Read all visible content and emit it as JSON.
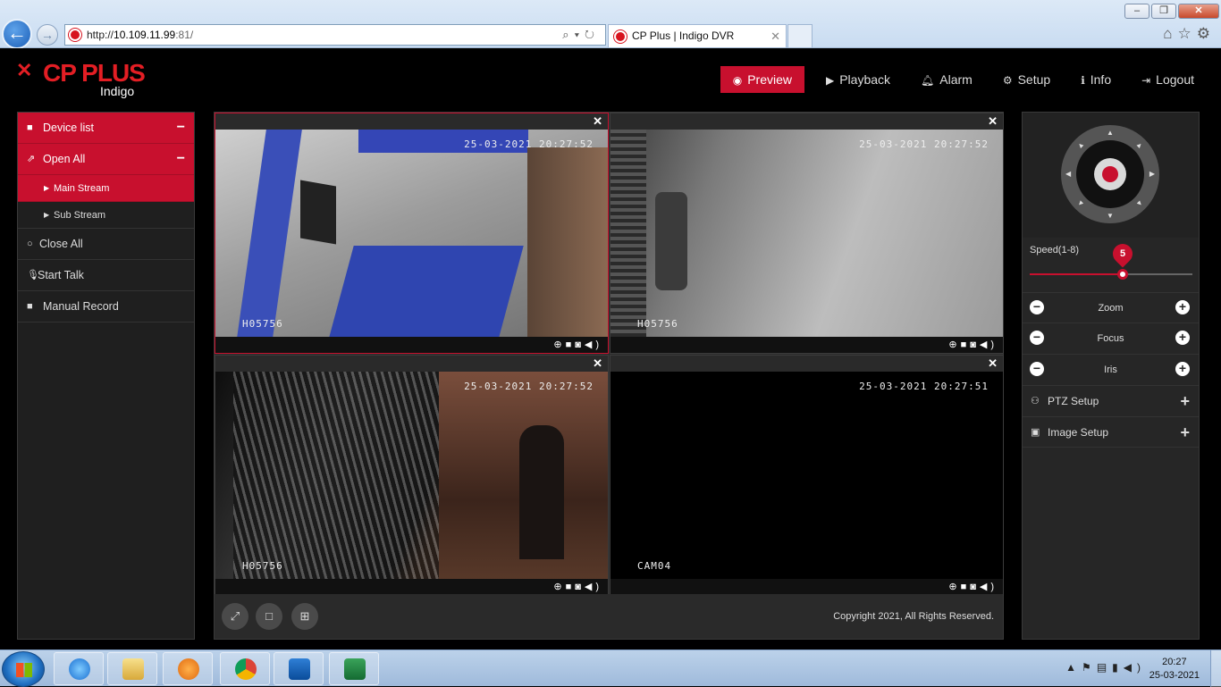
{
  "browser": {
    "url_prefix": "http://",
    "url_host": "10.109.11.99",
    "url_rest": ":81/",
    "tab_title": "CP Plus | Indigo DVR",
    "nav_back_icon": "back-arrow-icon",
    "nav_forward_icon": "forward-arrow-icon"
  },
  "header": {
    "brand": "CP PLUS",
    "product": "Indigo",
    "menu": [
      {
        "label": "Preview",
        "icon": "eye-icon",
        "active": true
      },
      {
        "label": "Playback",
        "icon": "play-icon",
        "active": false
      },
      {
        "label": "Alarm",
        "icon": "bell-icon",
        "active": false
      },
      {
        "label": "Setup",
        "icon": "gear-icon",
        "active": false
      },
      {
        "label": "Info",
        "icon": "info-icon",
        "active": false
      },
      {
        "label": "Logout",
        "icon": "logout-icon",
        "active": false
      }
    ]
  },
  "sidebar": {
    "device_list": "Device list",
    "open_all": "Open All",
    "main_stream": "Main Stream",
    "sub_stream": "Sub Stream",
    "close_all": "Close All",
    "start_talk": "Start Talk",
    "manual_record": "Manual Record"
  },
  "cameras": [
    {
      "timestamp": "25-03-2021 20:27:52",
      "name": "H05756"
    },
    {
      "timestamp": "25-03-2021 20:27:52",
      "name": "H05756"
    },
    {
      "timestamp": "25-03-2021 20:27:52",
      "name": "H05756"
    },
    {
      "timestamp": "25-03-2021 20:27:51",
      "name": "CAM04"
    }
  ],
  "footer": {
    "copyright": "Copyright 2021, All Rights Reserved."
  },
  "ptz": {
    "speed_label": "Speed(1-8)",
    "speed_value": "5",
    "speed_min": 1,
    "speed_max": 8,
    "zoom": "Zoom",
    "focus": "Focus",
    "iris": "Iris",
    "ptz_setup": "PTZ Setup",
    "image_setup": "Image Setup"
  },
  "taskbar": {
    "apps": [
      "internet-explorer-icon",
      "file-explorer-icon",
      "media-player-icon",
      "chrome-icon",
      "outlook-icon",
      "excel-icon"
    ],
    "time": "20:27",
    "date": "25-03-2021"
  },
  "colors": {
    "accent": "#c8102e",
    "brand_red": "#e31e24",
    "panel": "#262626",
    "background": "#000000"
  }
}
